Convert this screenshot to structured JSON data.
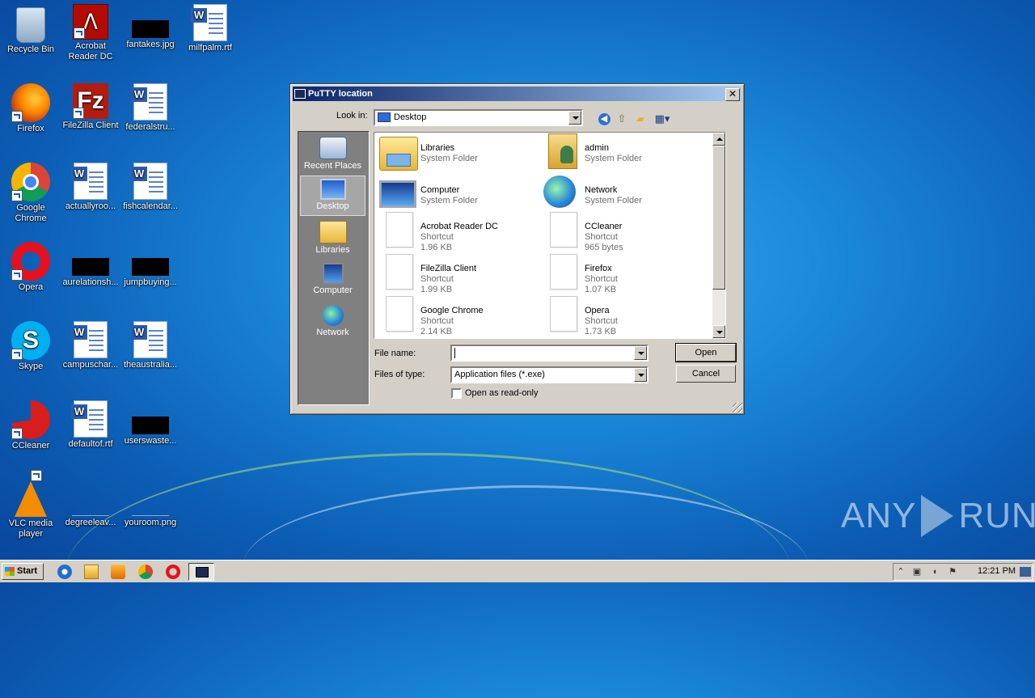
{
  "desktop": {
    "icons": [
      {
        "label": "Recycle Bin",
        "icon": "recycle-bin-icon"
      },
      {
        "label": "Acrobat Reader DC",
        "icon": "acrobat-icon"
      },
      {
        "label": "fantakes.jpg",
        "icon": "image-file-icon"
      },
      {
        "label": "milfpalm.rtf",
        "icon": "word-doc-icon"
      },
      {
        "label": "Firefox",
        "icon": "firefox-icon"
      },
      {
        "label": "FileZilla Client",
        "icon": "filezilla-icon"
      },
      {
        "label": "federalstru...",
        "icon": "word-doc-icon"
      },
      {
        "label": "Google Chrome",
        "icon": "chrome-icon"
      },
      {
        "label": "actuallyroo...",
        "icon": "word-doc-icon"
      },
      {
        "label": "fishcalendar...",
        "icon": "word-doc-icon"
      },
      {
        "label": "Opera",
        "icon": "opera-icon"
      },
      {
        "label": "aurelationsh...",
        "icon": "image-file-icon"
      },
      {
        "label": "jumpbuying...",
        "icon": "image-file-icon"
      },
      {
        "label": "Skype",
        "icon": "skype-icon"
      },
      {
        "label": "campuschar...",
        "icon": "word-doc-icon"
      },
      {
        "label": "theaustralia...",
        "icon": "word-doc-icon"
      },
      {
        "label": "CCleaner",
        "icon": "ccleaner-icon"
      },
      {
        "label": "defaultof.rtf",
        "icon": "word-doc-icon"
      },
      {
        "label": "userswaste...",
        "icon": "image-file-icon"
      },
      {
        "label": "VLC media player",
        "icon": "vlc-icon"
      },
      {
        "label": "degreeleav...",
        "icon": "image-file-icon"
      },
      {
        "label": "youroom.png",
        "icon": "image-file-icon"
      }
    ],
    "watermark": "ANY RUN"
  },
  "dialog": {
    "title": "PuTTY location",
    "look_in_label": "Look in:",
    "look_in_value": "Desktop",
    "places": [
      "Recent Places",
      "Desktop",
      "Libraries",
      "Computer",
      "Network"
    ],
    "selected_place": "Desktop",
    "files": [
      {
        "name": "Libraries",
        "type": "System Folder",
        "size": ""
      },
      {
        "name": "admin",
        "type": "System Folder",
        "size": ""
      },
      {
        "name": "Computer",
        "type": "System Folder",
        "size": ""
      },
      {
        "name": "Network",
        "type": "System Folder",
        "size": ""
      },
      {
        "name": "Acrobat Reader DC",
        "type": "Shortcut",
        "size": "1.96 KB"
      },
      {
        "name": "CCleaner",
        "type": "Shortcut",
        "size": "965 bytes"
      },
      {
        "name": "FileZilla Client",
        "type": "Shortcut",
        "size": "1.99 KB"
      },
      {
        "name": "Firefox",
        "type": "Shortcut",
        "size": "1.07 KB"
      },
      {
        "name": "Google Chrome",
        "type": "Shortcut",
        "size": "2.14 KB"
      },
      {
        "name": "Opera",
        "type": "Shortcut",
        "size": "1.73 KB"
      }
    ],
    "file_name_label": "File name:",
    "file_name_value": "",
    "files_of_type_label": "Files of type:",
    "files_of_type_value": "Application files (*.exe)",
    "read_only_label": "Open as read-only",
    "open_label": "Open",
    "cancel_label": "Cancel"
  },
  "taskbar": {
    "start_label": "Start",
    "clock": "12:21 PM"
  }
}
